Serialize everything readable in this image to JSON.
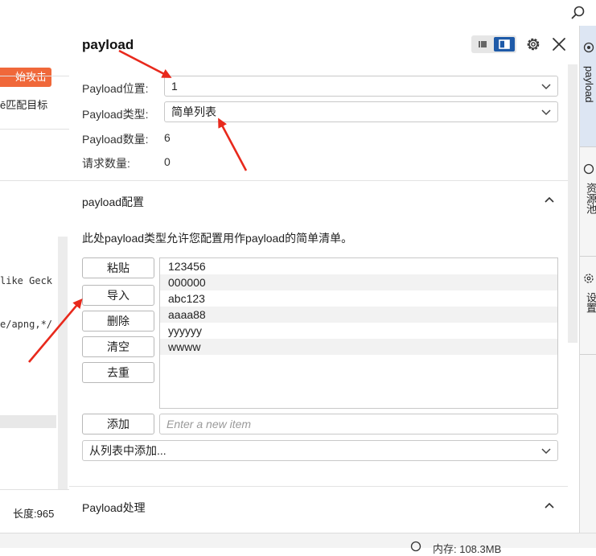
{
  "left": {
    "start_button": "始攻击",
    "match_target": "ē匹配目标",
    "code_line1": "like Geck",
    "code_line2": "e/apng,*/",
    "length_label": "长度:965"
  },
  "panel": {
    "title": "payload",
    "position_label": "Payload位置:",
    "position_value": "1",
    "type_label": "Payload类型:",
    "type_value": "简单列表",
    "count_label": "Payload数量:",
    "count_value": "6",
    "request_label": "请求数量:",
    "request_value": "0"
  },
  "config": {
    "section_title": "payload配置",
    "description": "此处payload类型允许您配置用作payload的简单清单。",
    "buttons": {
      "paste": "粘贴",
      "import": "导入",
      "remove": "删除",
      "clear": "清空",
      "dedupe": "去重",
      "add": "添加"
    },
    "items": [
      "123456",
      "000000",
      "abc123",
      "aaaa88",
      "yyyyyy",
      "wwww"
    ],
    "add_placeholder": "Enter a new item",
    "add_from_list": "从列表中添加..."
  },
  "processing": {
    "section_title": "Payload处理"
  },
  "right_tabs": [
    "payload",
    "资源池",
    "设置"
  ],
  "status": {
    "memory": "内存: 108.3MB"
  },
  "colors": {
    "accent": "#1e5aa8",
    "start_button": "#f0683a",
    "annotation_arrow": "#e8291c"
  }
}
